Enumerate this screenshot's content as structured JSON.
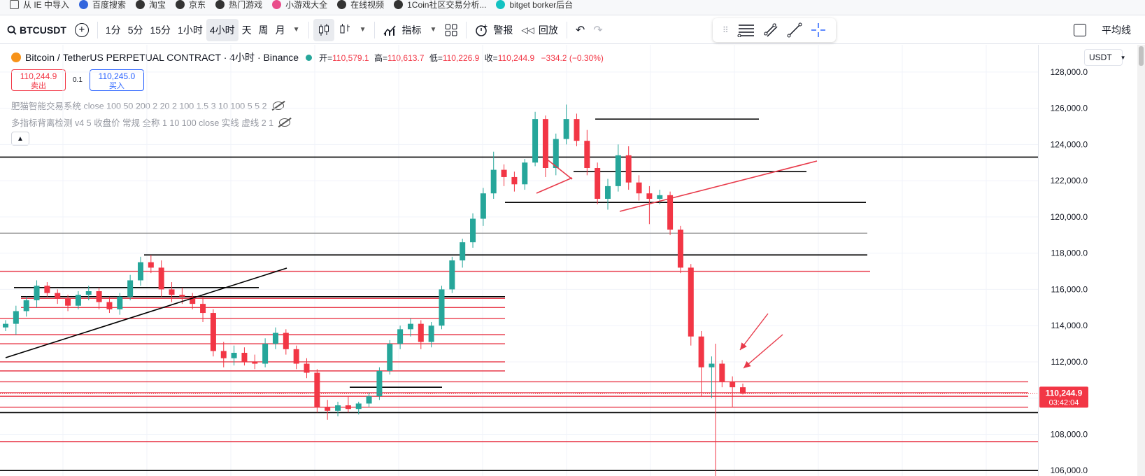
{
  "bookmarks": [
    {
      "label": "从 IE 中导入",
      "icon": "folder-icon"
    },
    {
      "label": "百度搜索",
      "icon": "paw-icon"
    },
    {
      "label": "淘宝",
      "icon": "globe-icon"
    },
    {
      "label": "京东",
      "icon": "globe-icon"
    },
    {
      "label": "热门游戏",
      "icon": "globe-icon"
    },
    {
      "label": "小游戏大全",
      "icon": "game-icon"
    },
    {
      "label": "在线视频",
      "icon": "globe-icon"
    },
    {
      "label": "1Coin社区交易分析...",
      "icon": "globe-icon"
    },
    {
      "label": "bitget borker后台",
      "icon": "bitget-icon"
    }
  ],
  "toolbar": {
    "symbol": "BTCUSDT",
    "intervals": [
      "1分",
      "5分",
      "15分",
      "1小时",
      "4小时",
      "天",
      "周",
      "月"
    ],
    "active_interval": "4小时",
    "indicators": "指标",
    "alert": "警报",
    "replay": "回放",
    "ma": "平均线"
  },
  "legend": {
    "title": "Bitcoin / TetherUS PERPETUAL CONTRACT · 4小时 · Binance",
    "open_label": "开=",
    "open": "110,579.1",
    "high_label": "高=",
    "high": "110,613.7",
    "low_label": "低=",
    "low": "110,226.9",
    "close_label": "收=",
    "close": "110,244.9",
    "change": "−334.2 (−0.30%)"
  },
  "trade": {
    "sell_price": "110,244.9",
    "sell_label": "卖出",
    "qty": "0.1",
    "buy_price": "110,245.0",
    "buy_label": "买入"
  },
  "indicators": [
    "肥猫智能交易系统 close 100 50 200 2 20 2 100 1.5 3 10 100 5 5 2",
    "多指标背离检测 v4 5 收盘价 常规 全称 1 10 100 close 实线 虚线 2 1"
  ],
  "currency": "USDT",
  "colors": {
    "up": "#26a69a",
    "down": "#f23645",
    "line_black": "#000000",
    "line_red": "#e83a4a"
  },
  "chart_data": {
    "type": "candlestick",
    "y_range": [
      105700,
      129500
    ],
    "y_ticks": [
      "106,000.0",
      "108,000.0",
      "110,000.0",
      "112,000.0",
      "114,000.0",
      "116,000.0",
      "118,000.0",
      "120,000.0",
      "122,000.0",
      "124,000.0",
      "126,000.0",
      "128,000.0"
    ],
    "last_price": "110,244.9",
    "countdown": "03:42:04",
    "ohlc_path": [
      [
        113900,
        114300,
        113700,
        114100
      ],
      [
        114100,
        115100,
        113500,
        114800
      ],
      [
        114800,
        115600,
        114500,
        115400
      ],
      [
        115400,
        116500,
        115000,
        116200
      ],
      [
        116200,
        116400,
        115600,
        115800
      ],
      [
        115800,
        116000,
        115200,
        115500
      ],
      [
        115500,
        115700,
        114800,
        115100
      ],
      [
        115100,
        115900,
        114900,
        115700
      ],
      [
        115700,
        116200,
        115400,
        115900
      ],
      [
        115900,
        116100,
        114900,
        115300
      ],
      [
        115300,
        115600,
        114700,
        114900
      ],
      [
        114900,
        115800,
        114600,
        115600
      ],
      [
        115600,
        116800,
        115400,
        116500
      ],
      [
        116500,
        117800,
        116200,
        117500
      ],
      [
        117500,
        117900,
        116900,
        117200
      ],
      [
        117200,
        117600,
        115600,
        116000
      ],
      [
        116000,
        116400,
        115300,
        115700
      ],
      [
        115700,
        116100,
        115200,
        115600
      ],
      [
        115600,
        115800,
        114900,
        115200
      ],
      [
        115200,
        115600,
        114200,
        114700
      ],
      [
        114700,
        114900,
        112300,
        112600
      ],
      [
        112600,
        113100,
        111700,
        112200
      ],
      [
        112200,
        112900,
        111800,
        112500
      ],
      [
        112500,
        112800,
        111800,
        112000
      ],
      [
        112000,
        112400,
        111600,
        111900
      ],
      [
        111900,
        113300,
        111700,
        113000
      ],
      [
        113000,
        113900,
        112700,
        113600
      ],
      [
        113600,
        113800,
        112400,
        112700
      ],
      [
        112700,
        112900,
        111600,
        111900
      ],
      [
        111900,
        112200,
        111100,
        111400
      ],
      [
        111400,
        111600,
        109200,
        109500
      ],
      [
        109500,
        109900,
        108800,
        109300
      ],
      [
        109300,
        109800,
        109000,
        109600
      ],
      [
        109600,
        110100,
        109200,
        109400
      ],
      [
        109400,
        109800,
        109100,
        109700
      ],
      [
        109700,
        110300,
        109500,
        110100
      ],
      [
        110100,
        111700,
        109900,
        111500
      ],
      [
        111500,
        113200,
        111300,
        113000
      ],
      [
        113000,
        114000,
        112700,
        113800
      ],
      [
        113800,
        114400,
        113400,
        114100
      ],
      [
        114100,
        114300,
        112700,
        113100
      ],
      [
        113100,
        114200,
        112800,
        114000
      ],
      [
        114000,
        116200,
        113800,
        116000
      ],
      [
        116000,
        117800,
        115800,
        117600
      ],
      [
        117600,
        118800,
        117200,
        118600
      ],
      [
        118600,
        120200,
        118300,
        119900
      ],
      [
        119900,
        121600,
        119500,
        121300
      ],
      [
        121300,
        123600,
        121000,
        122600
      ],
      [
        122600,
        122900,
        121700,
        122200
      ],
      [
        122200,
        122500,
        121400,
        121800
      ],
      [
        121800,
        123200,
        121500,
        123000
      ],
      [
        123000,
        125800,
        122800,
        125400
      ],
      [
        125400,
        125600,
        122200,
        122700
      ],
      [
        122700,
        124600,
        122300,
        124300
      ],
      [
        124300,
        126200,
        124000,
        125400
      ],
      [
        125400,
        125700,
        123900,
        124200
      ],
      [
        124200,
        124800,
        122300,
        122700
      ],
      [
        122700,
        123000,
        120700,
        121000
      ],
      [
        121000,
        122100,
        120400,
        121700
      ],
      [
        121700,
        124000,
        121400,
        123400
      ],
      [
        123400,
        123900,
        121500,
        121900
      ],
      [
        121900,
        122300,
        120900,
        121300
      ],
      [
        121300,
        121700,
        119600,
        121000
      ],
      [
        121000,
        121500,
        120700,
        121200
      ],
      [
        121200,
        121400,
        119000,
        119300
      ],
      [
        119300,
        119500,
        116900,
        117200
      ],
      [
        117200,
        117400,
        112900,
        113400
      ],
      [
        113400,
        113700,
        110100,
        111700
      ],
      [
        111700,
        112300,
        110000,
        111900
      ],
      [
        111900,
        112100,
        110600,
        110900
      ],
      [
        110900,
        111200,
        109500,
        110600
      ],
      [
        110600,
        110800,
        110200,
        110245
      ]
    ],
    "h_lines_black": [
      123300,
      119100,
      117900,
      116100,
      115600,
      110600,
      109200,
      106000,
      120800,
      122500,
      125400
    ],
    "h_lines_red": [
      117000,
      115500,
      115000,
      114400,
      113500,
      113000,
      112000,
      111500,
      110900,
      110300,
      110100,
      109500,
      107600
    ],
    "trend_lines": [
      {
        "color": "black",
        "from": [
          0,
          111600
        ],
        "to": [
          0.262,
          116900
        ]
      },
      {
        "color": "red",
        "from": [
          0.565,
          121300
        ],
        "to": [
          0.745,
          123300
        ]
      },
      {
        "color": "red",
        "from": [
          0.489,
          121300
        ],
        "to": [
          0.524,
          122500
        ]
      },
      {
        "color": "red",
        "from": [
          0.489,
          123300
        ],
        "to": [
          0.524,
          122300
        ]
      }
    ],
    "arrows": [
      {
        "from": [
          0.701,
          114200
        ],
        "to": [
          0.672,
          111900
        ]
      },
      {
        "from": [
          0.714,
          113200
        ],
        "to": [
          0.676,
          110800
        ]
      }
    ]
  }
}
